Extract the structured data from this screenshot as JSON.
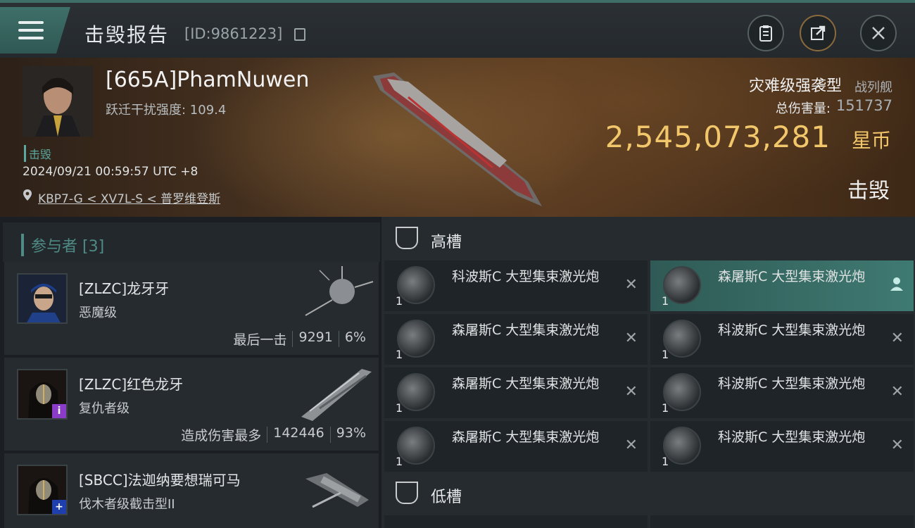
{
  "header": {
    "title": "击毁报告",
    "kill_id": "[ID:9861223]"
  },
  "victim": {
    "name": "[665A]PhamNuwen",
    "warp_label": "跃迁干扰强度: 109.4",
    "tag": "击毁",
    "datetime": "2024/09/21 00:59:57 UTC +8",
    "location": "KBP7-G < XV7L-S < 普罗维登斯",
    "ship_class": "灾难级强袭型",
    "ship_type": "战列舰",
    "damage_label": "总伤害量:",
    "damage_value": "151737",
    "isk_value": "2,545,073,281",
    "isk_unit": "星币",
    "status": "击毁"
  },
  "participants": {
    "title": "参与者 [3]",
    "rows": [
      {
        "name": "[ZLZC]龙牙牙",
        "ship": "恶魔级",
        "stat_label": "最后一击",
        "damage": "9291",
        "percent": "6%"
      },
      {
        "name": "[ZLZC]红色龙牙",
        "ship": "复仇者级",
        "stat_label": "造成伤害最多",
        "damage": "142446",
        "percent": "93%",
        "badge": "i"
      },
      {
        "name": "[SBCC]法迦纳要想瑞可马",
        "ship": "伐木者级截击型II",
        "badge": "+"
      }
    ]
  },
  "fittings": {
    "high_label": "高槽",
    "low_label": "低槽",
    "modules": [
      {
        "name": "科波斯C 大型集束激光炮",
        "qty": "1"
      },
      {
        "name": "森屠斯C 大型集束激光炮",
        "qty": "1"
      },
      {
        "name": "森屠斯C 大型集束激光炮",
        "qty": "1"
      },
      {
        "name": "科波斯C 大型集束激光炮",
        "qty": "1"
      },
      {
        "name": "森屠斯C 大型集束激光炮",
        "qty": "1"
      },
      {
        "name": "科波斯C 大型集束激光炮",
        "qty": "1"
      },
      {
        "name": "森屠斯C 大型集束激光炮",
        "qty": "1"
      },
      {
        "name": "科波斯C 大型集束激光炮",
        "qty": "1"
      }
    ],
    "remove_glyph": "✕"
  }
}
